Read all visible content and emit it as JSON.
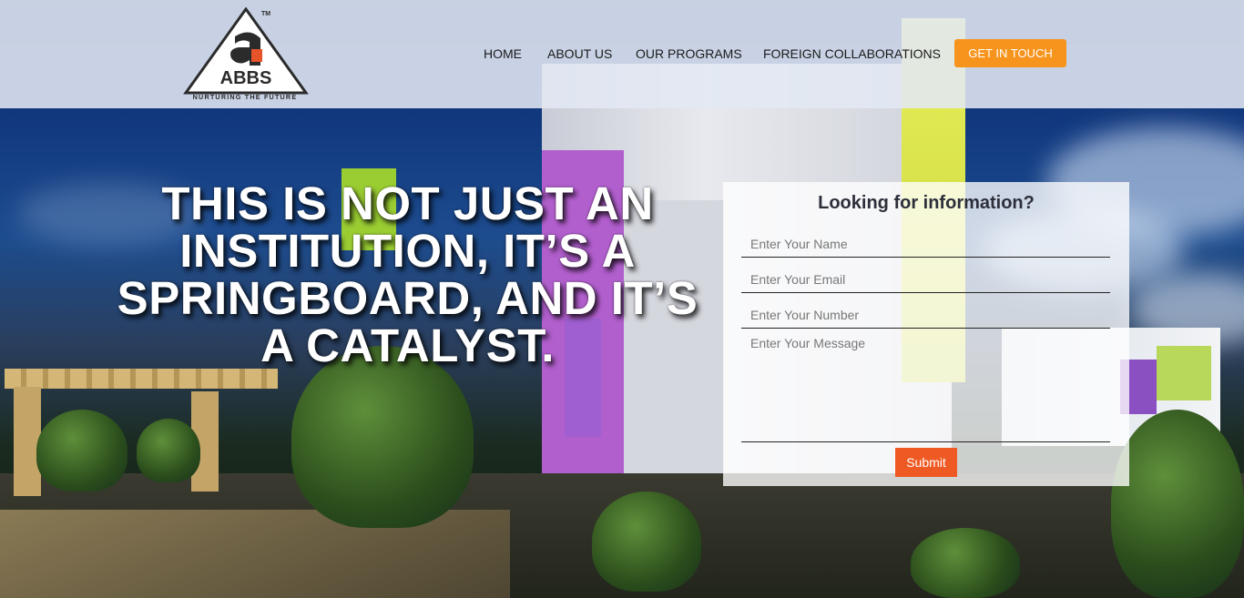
{
  "brand": {
    "name": "ABBS",
    "tagline": "NURTURING THE FUTURE",
    "trademark": "TM",
    "colors": {
      "accent_orange": "#f7941d",
      "submit_orange": "#ef5a24",
      "logo_dark": "#2b2b2b"
    }
  },
  "nav": {
    "home": "HOME",
    "about": "ABOUT US",
    "programs": "OUR PROGRAMS",
    "foreign": "FOREIGN COLLABORATIONS",
    "cta": "GET IN TOUCH"
  },
  "hero": {
    "headline": "THIS IS NOT JUST AN INSTITUTION, IT’S A SPRINGBOARD, AND IT’S A CATALYST."
  },
  "form": {
    "title": "Looking for information?",
    "name_placeholder": "Enter Your Name",
    "email_placeholder": "Enter Your Email",
    "number_placeholder": "Enter Your Number",
    "message_placeholder": "Enter Your Message",
    "submit": "Submit"
  }
}
